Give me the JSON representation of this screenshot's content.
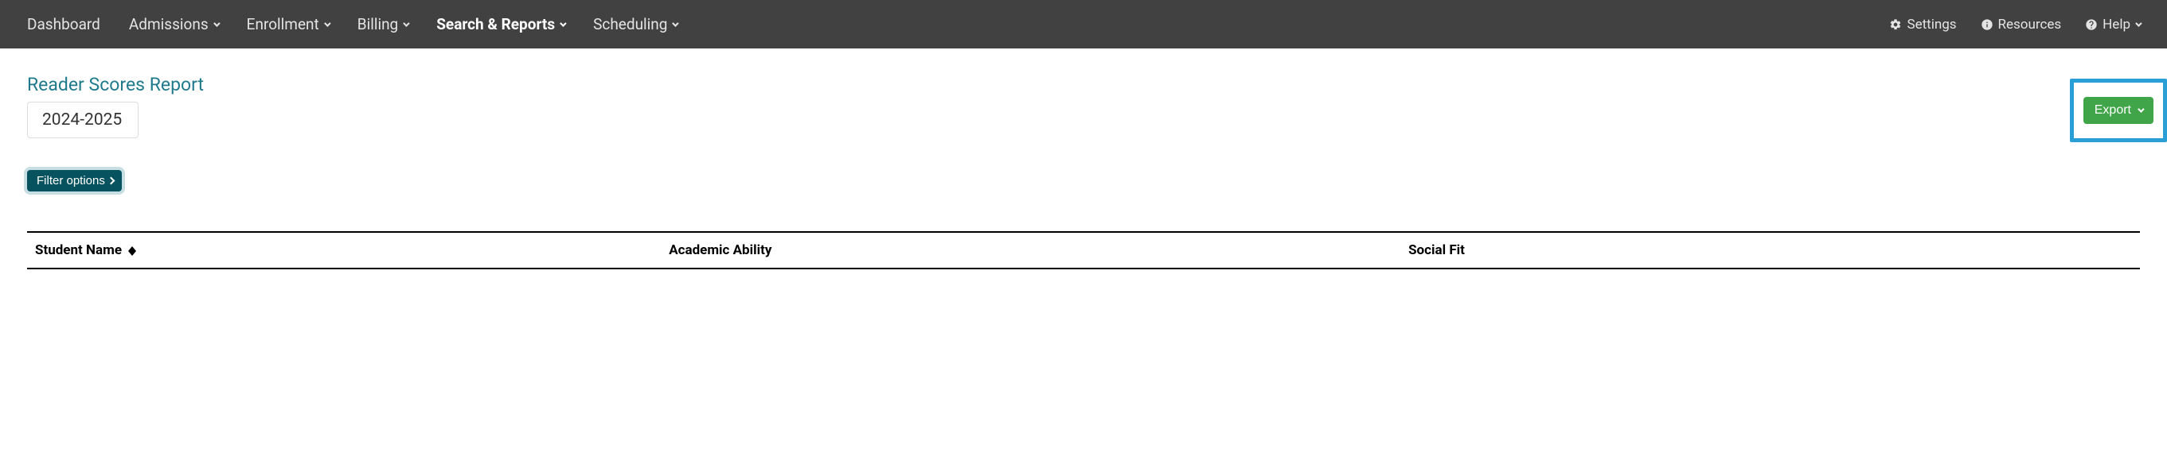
{
  "nav": {
    "left": [
      {
        "label": "Dashboard",
        "dropdown": false,
        "active": false
      },
      {
        "label": "Admissions",
        "dropdown": true,
        "active": false
      },
      {
        "label": "Enrollment",
        "dropdown": true,
        "active": false
      },
      {
        "label": "Billing",
        "dropdown": true,
        "active": false
      },
      {
        "label": "Search & Reports",
        "dropdown": true,
        "active": true
      },
      {
        "label": "Scheduling",
        "dropdown": true,
        "active": false
      }
    ],
    "right": {
      "settings": "Settings",
      "resources": "Resources",
      "help": "Help"
    }
  },
  "page": {
    "title": "Reader Scores Report",
    "year": "2024-2025",
    "export_label": "Export",
    "filter_label": "Filter options"
  },
  "table": {
    "columns": {
      "c1": "Student Name",
      "c2": "Academic Ability",
      "c3": "Social Fit"
    }
  }
}
